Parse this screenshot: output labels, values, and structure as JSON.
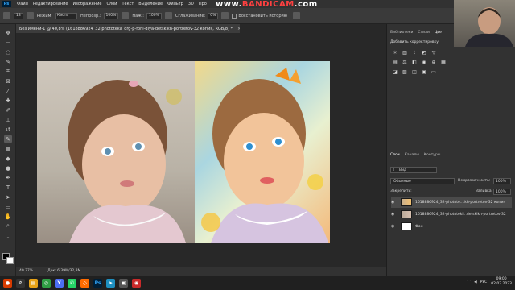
{
  "menubar": {
    "app_logo": "Ps",
    "items": [
      "Файл",
      "Редактирование",
      "Изображение",
      "Слои",
      "Текст",
      "Выделение",
      "Фильтр",
      "3D",
      "Про"
    ]
  },
  "watermark": {
    "text_pre": "www.",
    "text_main": "BANDICAM",
    "text_post": ".com"
  },
  "options": {
    "brush_size": "18",
    "mode_label": "Режим:",
    "mode_value": "Кисть",
    "opacity_label": "Непрозр.:",
    "opacity_value": "100%",
    "pressure_label": "Наж.:",
    "pressure_value": "100%",
    "smoothing_label": "Сглаживание:",
    "smoothing_value": "0%",
    "restore_label": "Восстановить историю"
  },
  "document": {
    "tab_title": "Без имени-1 @ 40,8% (1618886924_32-phototeka_org-p-foni-dlya-detskikh-portretov-32 копия, RGB/8) *",
    "close": "×"
  },
  "status": {
    "zoom": "40.77%",
    "doc_info": "Док: 6,39M/32,8M"
  },
  "panels": {
    "top_tabs": [
      "Библиотеки",
      "Стили",
      "Цве"
    ],
    "adjustments_title": "Добавить корректировку",
    "layers_tabs": [
      "Слои",
      "Каналы",
      "Контуры"
    ],
    "filter_label": "Вид",
    "blend_mode": "Обычные",
    "opacity_label": "Непрозрачность:",
    "opacity_value": "100%",
    "lock_label": "Закрепить:",
    "fill_label": "Заливка:",
    "fill_value": "100%",
    "layers": [
      {
        "name": "1618886924_32-photote...ikh-portretov-32 копия",
        "selected": true
      },
      {
        "name": "1618886924_32-phototeki...detskikh-portretov-32",
        "selected": false
      },
      {
        "name": "Фон",
        "selected": false
      }
    ]
  },
  "taskbar": {
    "lang": "РУС",
    "time": "09:00",
    "date": "02.03.2023"
  },
  "colors": {
    "accent": "#31a8ff",
    "background": "#262626",
    "panel": "#323232"
  }
}
